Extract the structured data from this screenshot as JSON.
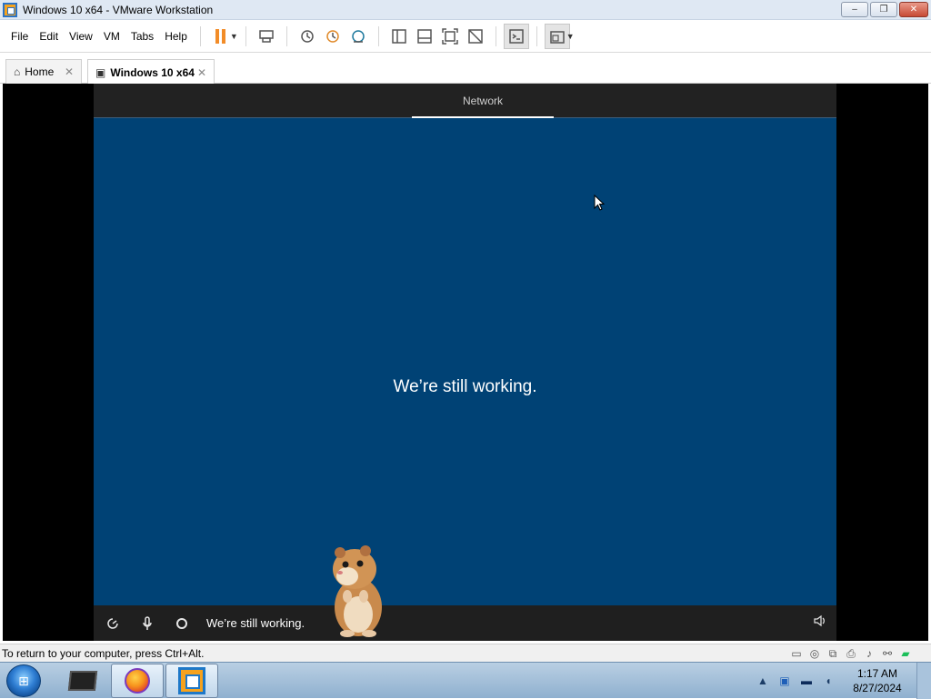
{
  "window": {
    "title": "Windows 10 x64 - VMware Workstation",
    "buttons": {
      "minimize": "–",
      "restore": "❐",
      "close": "✕"
    }
  },
  "menu": {
    "items": [
      "File",
      "Edit",
      "View",
      "VM",
      "Tabs",
      "Help"
    ]
  },
  "toolbar": {
    "icons": [
      "pause-icon",
      "dropdown-icon",
      "send-ctrl-alt-del-icon",
      "snapshot-icon",
      "revert-snapshot-icon",
      "snapshot-manager-icon",
      "library-icon",
      "thumbnail-icon",
      "full-screen-icon",
      "unity-icon",
      "console-icon",
      "stretch-icon"
    ]
  },
  "tabs": {
    "home": {
      "label": "Home",
      "close": "✕"
    },
    "vm": {
      "label": "Windows 10 x64",
      "close": "✕"
    }
  },
  "guest": {
    "top_label": "Network",
    "main_text": "We’re still working.",
    "bottom_text": "We’re still working.",
    "bottom_icons": [
      "ease-of-access-icon",
      "microphone-icon",
      "cortana-icon",
      "volume-icon"
    ],
    "colors": {
      "background": "#004275",
      "topbar": "#222222",
      "bottombar": "#1f1f1f"
    }
  },
  "statusbar": {
    "text": "To return to your computer, press Ctrl+Alt."
  },
  "taskbar": {
    "apps": [
      "start-orb",
      "command-prompt-icon",
      "firefox-icon",
      "vmware-workstation-icon"
    ],
    "tray": {
      "time": "1:17 AM",
      "date": "8/27/2024"
    }
  }
}
